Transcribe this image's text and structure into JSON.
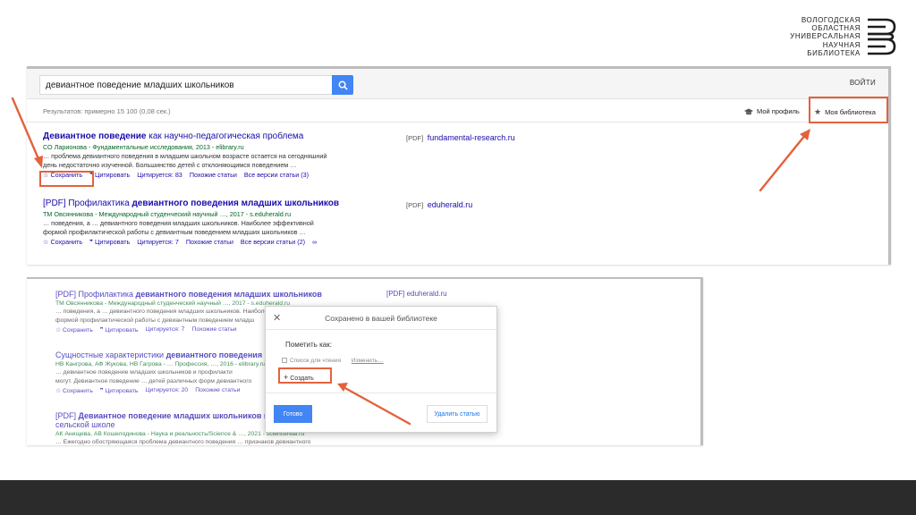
{
  "logo": {
    "lines": [
      "ВОЛОГОДСКАЯ",
      "ОБЛАСТНАЯ",
      "УНИВЕРСАЛЬНАЯ",
      "НАУЧНАЯ",
      "БИБЛИОТЕКА"
    ]
  },
  "search": {
    "value": "девиантное поведение младших школьников",
    "signin": "ВОЙТИ"
  },
  "toolbar": {
    "results_count": "Результатов: примерно 15 100 (0,08 сек.)",
    "my_profile": "Мой профиль",
    "my_library": "Моя библиотека"
  },
  "results": [
    {
      "title_bold": "Девиантное поведение",
      "title_rest": " как научно-педагогическая проблема",
      "source": "СО Ларионова - Фундаментальные исследования, 2013 - elibrary.ru",
      "snippet1": "… проблема девиантного поведения в младшем школьном возрасте остается на сегодняшний",
      "snippet2": "день недостаточно изученной. Большинство детей с отклоняющимся поведением …",
      "save": "Сохранить",
      "cite": "Цитировать",
      "cited_by": "Цитируется: 83",
      "related": "Похожие статьи",
      "versions": "Все версии статьи (3)",
      "side_format": "[PDF]",
      "side_site": "fundamental-research.ru"
    },
    {
      "title_prefix": "[PDF] Профилактика ",
      "title_bold": "девиантного поведения младших школьников",
      "source": "ТМ Овсянникова - Международный студенческий научный …, 2017 - s.eduherald.ru",
      "snippet1": "… поведения, а … девиантного поведения младших школьников. Наиболее эффективной",
      "snippet2": "формой профилактической работы с девиантным поведением младших школьников …",
      "save": "Сохранить",
      "cite": "Цитировать",
      "cited_by": "Цитируется: 7",
      "related": "Похожие статьи",
      "versions": "Все версии статьи (2)",
      "side_format": "[PDF]",
      "side_site": "eduherald.ru"
    }
  ],
  "results2": [
    {
      "title_prefix": "[PDF] Профилактика ",
      "title_bold": "девиантного поведения младших школьников",
      "source": "ТМ Овсянникова - Международный студенческий научный …, 2017 - s.eduherald.ru",
      "snippet1": "… поведения, а … девиантного поведения младших школьников. Наиболее",
      "snippet2": "формой профилактической работы с девиантным поведением младш",
      "save": "Сохранить",
      "cite": "Цитировать",
      "cited_by": "Цитируется: 7",
      "related": "Похожие статьи",
      "side_site": "[PDF] eduherald.ru"
    },
    {
      "title_prefix": "Сущностные характеристики ",
      "title_bold": "девиантного поведения",
      "source": "НВ Кангрова, АФ Жукова, НВ Гагрова - … Профессия, …, 2016 - elibrary.ru",
      "snippet1": "… девиантное поведение младших школьников и профилакти",
      "snippet2": "могут. Девиантное поведение … детей различных форм девиантного",
      "save": "Сохранить",
      "cite": "Цитировать",
      "cited_by": "Цитируется: 20",
      "related": "Похожие статьи"
    },
    {
      "title_prefix": "[PDF] ",
      "title_bold": "Девиантное поведение младших школьников",
      "title_rest": " в",
      "title_line2": "сельской школе",
      "source": "АК Анищева, АВ Кошелодинова - Наука и реальность/Science & …, 2021 - sciencereal.ru",
      "snippet1": "… Ежегодно обостряющаяся проблема девиантного поведения … признаков девиантного"
    }
  ],
  "dialog": {
    "title": "Сохранено в вашей библиотеке",
    "label": "Пометить как:",
    "checkbox_label": "Список для чтения",
    "edit": "Изменить…",
    "create": "Создать",
    "done": "Готово",
    "remove": "Удалить статью"
  },
  "colors": {
    "accent": "#e3623c",
    "link": "#1a0dab",
    "source": "#006621",
    "button": "#4285f4",
    "footer": "#2b2b2b"
  }
}
